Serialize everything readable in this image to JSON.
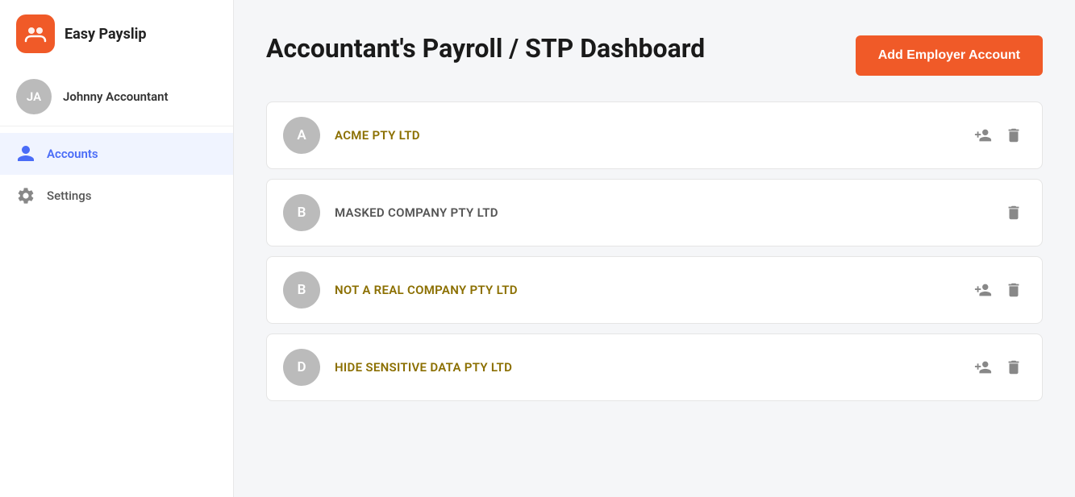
{
  "app": {
    "logo_text": "Easy Payslip"
  },
  "sidebar": {
    "user": {
      "initials": "JA",
      "name": "Johnny Accountant"
    },
    "nav_items": [
      {
        "id": "accounts",
        "label": "Accounts",
        "active": true,
        "icon": "person-icon"
      },
      {
        "id": "settings",
        "label": "Settings",
        "active": false,
        "icon": "gear-icon"
      }
    ]
  },
  "main": {
    "page_title": "Accountant's Payroll / STP Dashboard",
    "add_button_label": "Add Employer Account",
    "accounts": [
      {
        "id": 1,
        "initial": "A",
        "name": "ACME PTY LTD",
        "has_add_user": true,
        "has_delete": true,
        "name_color": "gold"
      },
      {
        "id": 2,
        "initial": "B",
        "name": "MASKED COMPANY PTY LTD",
        "has_add_user": false,
        "has_delete": true,
        "name_color": "dark"
      },
      {
        "id": 3,
        "initial": "B",
        "name": "NOT A REAL COMPANY PTY LTD",
        "has_add_user": true,
        "has_delete": true,
        "name_color": "gold"
      },
      {
        "id": 4,
        "initial": "D",
        "name": "HIDE SENSITIVE DATA PTY LTD",
        "has_add_user": true,
        "has_delete": true,
        "name_color": "gold"
      }
    ]
  }
}
